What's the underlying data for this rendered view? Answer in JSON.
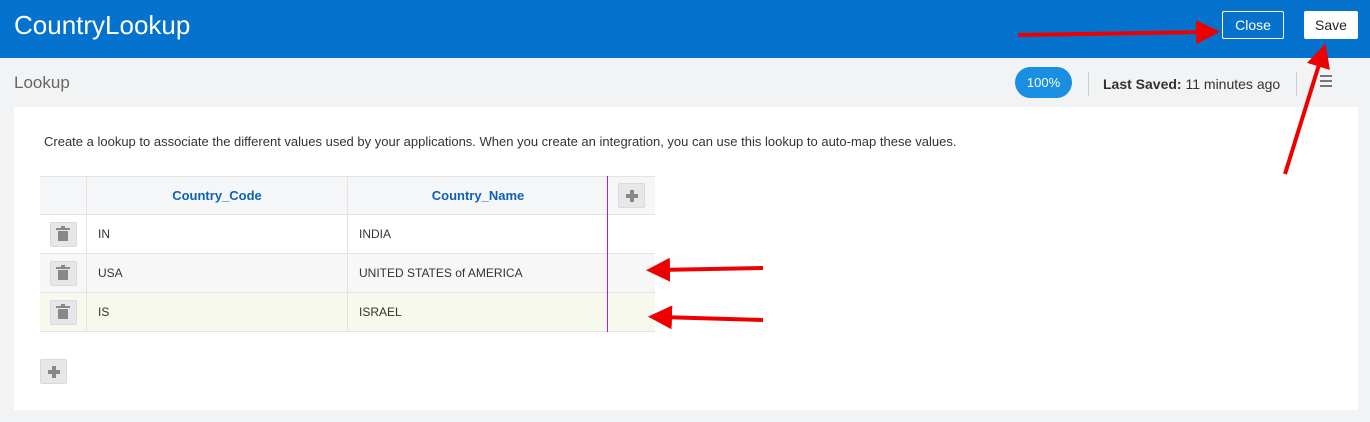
{
  "app": {
    "title": "CountryLookup"
  },
  "toolbar": {
    "close_label": "Close",
    "save_label": "Save"
  },
  "subheader": {
    "title": "Lookup",
    "progress": "100%",
    "last_saved_label": "Last Saved:",
    "last_saved_value": "11 minutes ago"
  },
  "description": "Create a lookup to associate the different values used by your applications. When you create an integration, you can use this lookup to auto-map these values.",
  "table": {
    "columns": [
      "Country_Code",
      "Country_Name"
    ],
    "rows": [
      {
        "code": "IN",
        "name": "INDIA"
      },
      {
        "code": "USA",
        "name": "UNITED STATES of AMERICA"
      },
      {
        "code": "IS",
        "name": "ISRAEL"
      }
    ]
  },
  "icons": {
    "delete": "trash-icon",
    "add_column": "plus-icon",
    "add_row": "plus-icon",
    "menu": "hamburger-icon"
  },
  "colors": {
    "header_bar": "#0572ce",
    "progress": "#1a8ee0",
    "column_header_text": "#0d62b5",
    "selected_row": "#f6f9ec",
    "annotation_arrow": "#ee0000"
  }
}
